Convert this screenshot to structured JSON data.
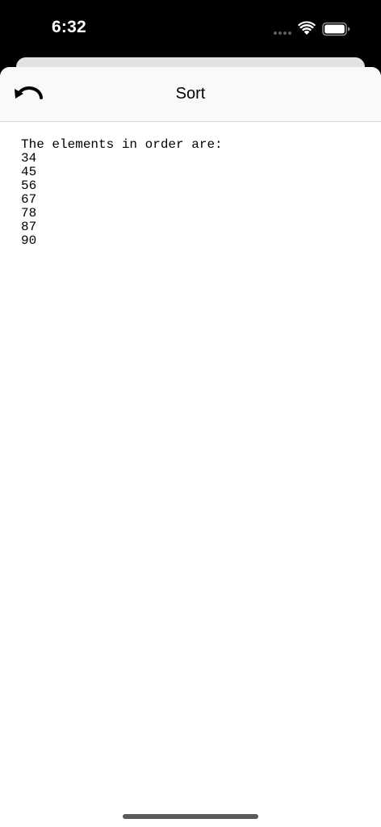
{
  "status_bar": {
    "time": "6:32",
    "signal_icon": "cellular-signal-icon",
    "wifi_icon": "wifi-icon",
    "battery_icon": "battery-icon"
  },
  "nav": {
    "title": "Sort",
    "back_icon": "undo-arrow-icon"
  },
  "content": {
    "heading": "The elements in order are:",
    "items": [
      "34",
      "45",
      "56",
      "67",
      "78",
      "87",
      "90"
    ]
  },
  "colors": {
    "status_bar_bg": "#000000",
    "nav_bg": "#f9f9f9",
    "sheet_bg": "#ffffff",
    "text": "#000000"
  }
}
